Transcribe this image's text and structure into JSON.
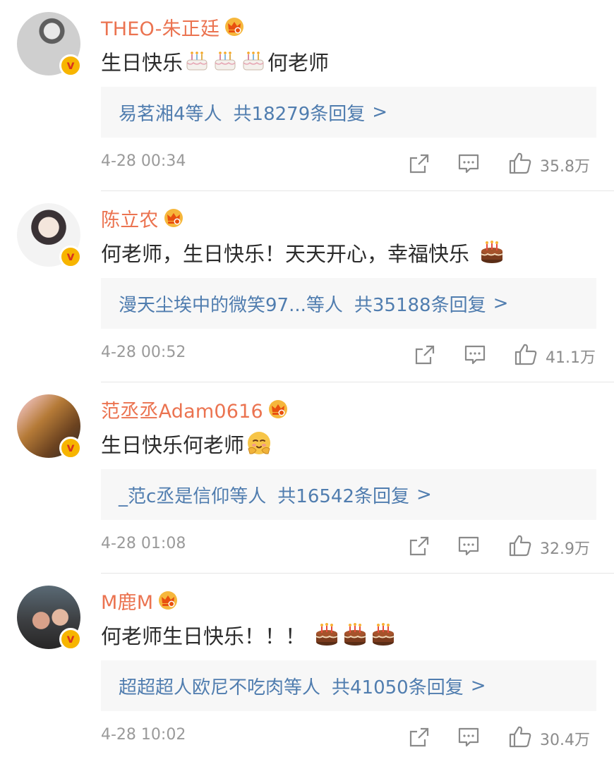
{
  "comments": [
    {
      "username": "THEO-朱正廷",
      "text_before": "生日快乐",
      "text_after": "何老师",
      "emoji": "cake-icon x3 (white)",
      "reply_users": "易茗湘4等人",
      "reply_count": "共18279条回复",
      "reply_arrow": ">",
      "timestamp": "4-28 00:34",
      "likes": "35.8万"
    },
    {
      "username": "陈立农",
      "text_before": "何老师，生日快乐！天天开心，幸福快乐",
      "text_after": "",
      "emoji": "cake-icon x1 (brown)",
      "reply_users": "漫天尘埃中的微笑97...等人",
      "reply_count": "共35188条回复",
      "reply_arrow": ">",
      "timestamp": "4-28 00:52",
      "likes": "41.1万"
    },
    {
      "username": "范丞丞Adam0616",
      "text_before": "生日快乐何老师",
      "text_after": "",
      "emoji": "hug-icon",
      "reply_users": "_范c丞是信仰等人",
      "reply_count": "共16542条回复",
      "reply_arrow": ">",
      "timestamp": "4-28 01:08",
      "likes": "32.9万"
    },
    {
      "username": "M鹿M",
      "text_before": "何老师生日快乐！！！",
      "text_after": "",
      "emoji": "cake-icon x3 (brown)",
      "reply_users": "超超超人欧尼不吃肉等人",
      "reply_count": "共41050条回复",
      "reply_arrow": ">",
      "timestamp": "4-28 10:02",
      "likes": "30.4万"
    }
  ],
  "colors": {
    "username": "#eb7350",
    "reply_link": "#507daf",
    "reply_bg": "#f7f7f7",
    "meta_text": "#9a9a9a",
    "verified_badge": "#f7b500"
  },
  "badge": {
    "verified_symbol": "v"
  }
}
